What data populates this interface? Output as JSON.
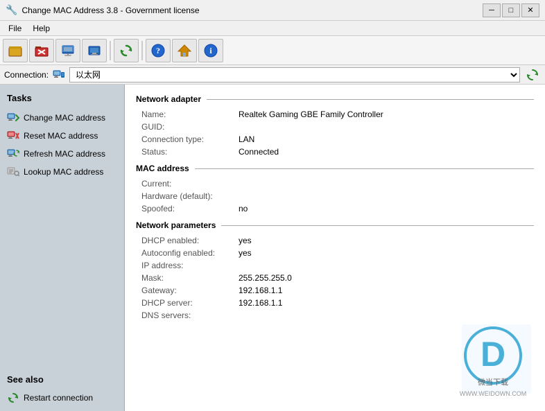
{
  "titleBar": {
    "icon": "🔧",
    "title": "Change MAC Address 3.8 - Government license",
    "minimizeBtn": "─",
    "maximizeBtn": "□",
    "closeBtn": "✕"
  },
  "menuBar": {
    "items": [
      {
        "label": "File"
      },
      {
        "label": "Help"
      }
    ]
  },
  "toolbar": {
    "buttons": [
      {
        "name": "open-icon",
        "icon": "📂"
      },
      {
        "name": "close-icon",
        "icon": "🚫"
      },
      {
        "name": "network-icon",
        "icon": "🌐"
      },
      {
        "name": "adapter-icon",
        "icon": "🖥"
      },
      {
        "name": "refresh-icon",
        "icon": "🔄"
      },
      {
        "name": "help-icon",
        "icon": "❓"
      },
      {
        "name": "home-icon",
        "icon": "🏠"
      },
      {
        "name": "info-icon",
        "icon": "ℹ"
      }
    ]
  },
  "connectionBar": {
    "label": "Connection:",
    "value": "以太网",
    "refreshIcon": "🔄"
  },
  "sidebar": {
    "tasksTitle": "Tasks",
    "items": [
      {
        "name": "change-mac",
        "label": "Change MAC address",
        "icon": "change"
      },
      {
        "name": "reset-mac",
        "label": "Reset MAC address",
        "icon": "reset"
      },
      {
        "name": "refresh-mac",
        "label": "Refresh MAC address",
        "icon": "refresh"
      },
      {
        "name": "lookup-mac",
        "label": "Lookup MAC address",
        "icon": "lookup"
      }
    ],
    "seeAlsoTitle": "See also",
    "seeAlsoItems": [
      {
        "name": "restart-connection",
        "label": "Restart connection",
        "icon": "restart"
      }
    ]
  },
  "content": {
    "networkAdapter": {
      "sectionTitle": "Network adapter",
      "rows": [
        {
          "label": "Name:",
          "value": "Realtek Gaming GBE Family Controller"
        },
        {
          "label": "GUID:",
          "value": ""
        },
        {
          "label": "Connection type:",
          "value": "LAN"
        },
        {
          "label": "Status:",
          "value": "Connected"
        }
      ]
    },
    "macAddress": {
      "sectionTitle": "MAC address",
      "rows": [
        {
          "label": "Current:",
          "value": ""
        },
        {
          "label": "Hardware (default):",
          "value": ""
        },
        {
          "label": "Spoofed:",
          "value": "no"
        }
      ]
    },
    "networkParameters": {
      "sectionTitle": "Network parameters",
      "rows": [
        {
          "label": "DHCP enabled:",
          "value": "yes"
        },
        {
          "label": "Autoconfig enabled:",
          "value": "yes"
        },
        {
          "label": "IP address:",
          "value": ""
        },
        {
          "label": "Mask:",
          "value": "255.255.255.0"
        },
        {
          "label": "Gateway:",
          "value": "192.168.1.1"
        },
        {
          "label": "DHCP server:",
          "value": "192.168.1.1"
        },
        {
          "label": "DNS servers:",
          "value": ""
        }
      ]
    }
  },
  "watermark": {
    "letter": "D",
    "text": "微当下载",
    "url": "WWW.WEIDOWN.COM"
  }
}
